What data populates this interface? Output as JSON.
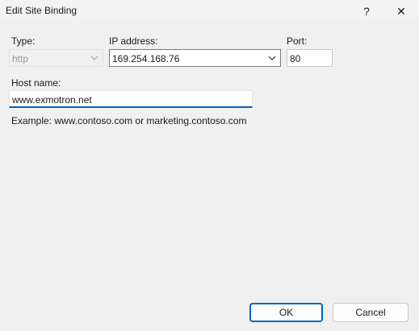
{
  "window": {
    "title": "Edit Site Binding",
    "help_glyph": "?",
    "close_glyph": "✕"
  },
  "form": {
    "type_label": "Type:",
    "type_value": "http",
    "ip_label": "IP address:",
    "ip_value": "169.254.168.76",
    "port_label": "Port:",
    "port_value": "80",
    "host_label": "Host name:",
    "host_value": "www.exmotron.net",
    "example_text": "Example: www.contoso.com or marketing.contoso.com"
  },
  "buttons": {
    "ok_label": "OK",
    "cancel_label": "Cancel"
  },
  "icons": {
    "help": "help-icon",
    "close": "close-icon",
    "dropdown": "chevron-down-icon"
  }
}
